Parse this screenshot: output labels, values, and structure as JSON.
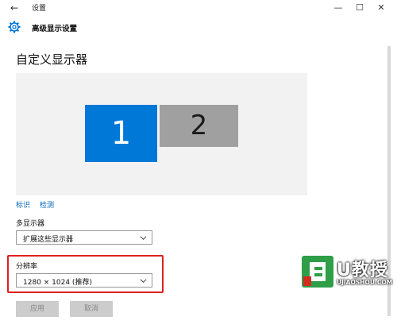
{
  "window": {
    "title": "设置",
    "back_glyph": "←",
    "minimize_glyph": "—",
    "maximize_glyph": "☐",
    "close_glyph": "✕"
  },
  "header": {
    "title": "高级显示设置",
    "icon": "gear-icon"
  },
  "page": {
    "title": "自定义显示器"
  },
  "displays": {
    "monitor_1_label": "1",
    "monitor_2_label": "2",
    "selected": "1"
  },
  "links": {
    "identify": "标识",
    "detect": "检测"
  },
  "multiple_displays": {
    "label": "多显示器",
    "value": "扩展这些显示器"
  },
  "resolution": {
    "label": "分辨率",
    "value": "1280 × 1024 (推荐)"
  },
  "buttons": {
    "apply": "应用",
    "cancel": "取消"
  },
  "watermark": {
    "text": "U教授",
    "url": "UJIAOSHOU.COM"
  },
  "colors": {
    "accent": "#0078d7",
    "link": "#0066b8",
    "highlight": "#e02020",
    "monitor_inactive": "#a0a0a0"
  }
}
